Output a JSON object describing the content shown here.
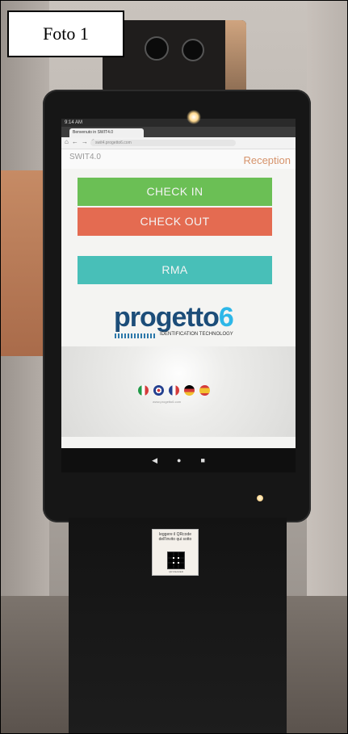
{
  "label": "Foto 1",
  "browser": {
    "status": "9:14 AM",
    "tab_title": "Benvenuto in SWIT4.0",
    "url": "swit4.progetto6.com"
  },
  "brand_left": "SWIT4.0",
  "brand_right": "Reception",
  "buttons": {
    "check_in": "CHECK IN",
    "check_out": "CHECK OUT",
    "rma": "RMA"
  },
  "logo": {
    "text": "progetto",
    "six": "6",
    "tagline": "IDENTIFICATION TECHNOLOGY"
  },
  "languages": [
    "Italian",
    "English",
    "French",
    "German",
    "Spanish"
  ],
  "website": "www.progetto6.com",
  "qr_card": {
    "text": "leggere il QRcode dell'invito qui sotto",
    "footer": "QR READER"
  }
}
